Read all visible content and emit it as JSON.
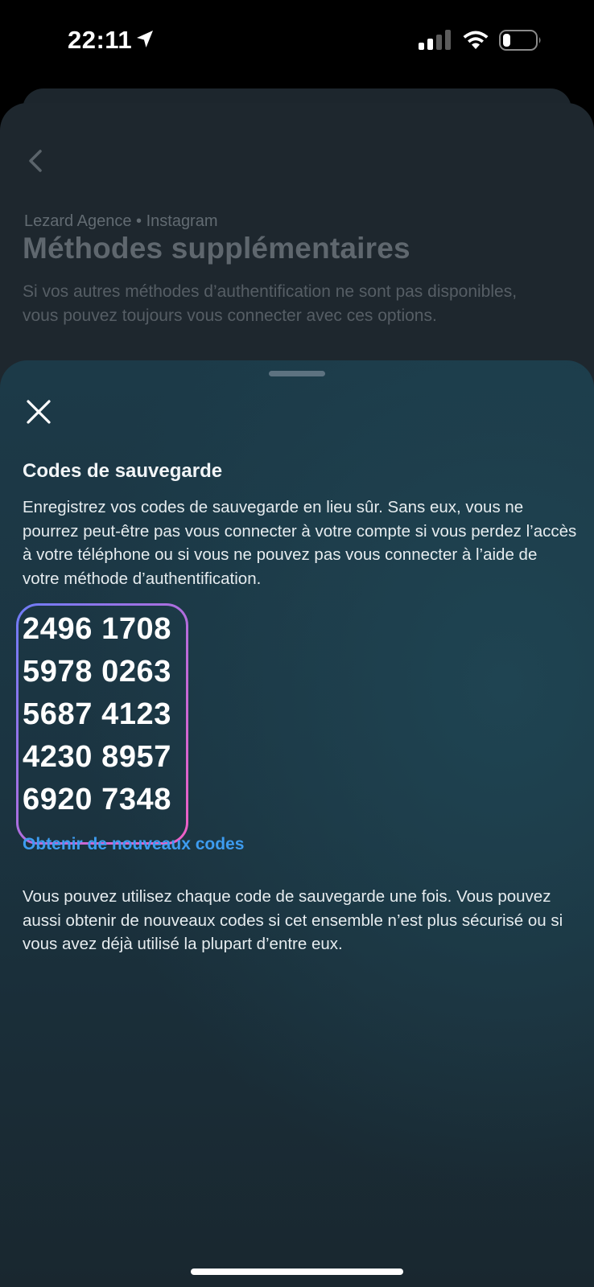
{
  "status_bar": {
    "time": "22:11",
    "location_icon": "location-arrow-icon",
    "signal_icon": "cellular-signal-icon",
    "wifi_icon": "wifi-icon",
    "battery_icon": "battery-low-icon"
  },
  "background_page": {
    "back_icon": "chevron-left-icon",
    "account": "Lezard Agence",
    "separator": "•",
    "app": "Instagram",
    "title": "Méthodes supplémentaires",
    "description": "Si vos autres méthodes d’authentification ne sont pas disponibles, vous pouvez toujours vous connecter avec ces options."
  },
  "sheet": {
    "close_icon": "close-icon",
    "title": "Codes de sauvegarde",
    "intro": "Enregistrez vos codes de sauvegarde en lieu sûr. Sans eux, vous ne pourrez peut-être pas vous connecter à votre compte si vous perdez l’accès à votre téléphone ou si vous ne pouvez pas vous connecter à l’aide de votre méthode d’authentification.",
    "codes": [
      "2496 1708",
      "5978 0263",
      "5687 4123",
      "4230 8957",
      "6920 7348"
    ],
    "new_codes_link": "Obtenir de nouveaux codes",
    "footer": "Vous pouvez utilisez chaque code de sauvegarde une fois. Vous pouvez aussi obtenir de nouveaux codes si cet ensemble n’est plus sécurisé ou si vous avez déjà utilisé la plupart d’entre eux."
  },
  "colors": {
    "link": "#3d9cf0",
    "highlight_gradient_start": "#6f7cf7",
    "highlight_gradient_end": "#f05fc4"
  }
}
